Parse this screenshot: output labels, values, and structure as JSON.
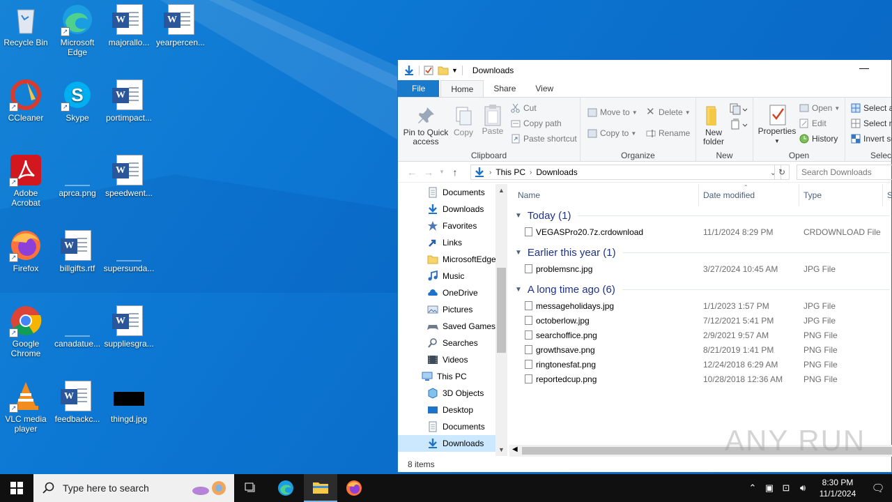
{
  "desktop": {
    "icons": [
      {
        "label": "Recycle Bin",
        "icon": "recycle-bin-icon"
      },
      {
        "label": "Microsoft Edge",
        "icon": "edge-icon"
      },
      {
        "label": "majorallo...",
        "icon": "word-doc-icon"
      },
      {
        "label": "yearpercen...",
        "icon": "word-doc-icon"
      },
      {
        "label": "CCleaner",
        "icon": "ccleaner-icon"
      },
      {
        "label": "Skype",
        "icon": "skype-icon"
      },
      {
        "label": "portimpact...",
        "icon": "word-doc-icon"
      },
      {
        "label": "Adobe Acrobat",
        "icon": "acrobat-icon"
      },
      {
        "label": "aprca.png",
        "icon": "image-file-icon"
      },
      {
        "label": "speedwent...",
        "icon": "word-doc-icon"
      },
      {
        "label": "Firefox",
        "icon": "firefox-icon"
      },
      {
        "label": "billgifts.rtf",
        "icon": "word-doc-icon"
      },
      {
        "label": "supersunda...",
        "icon": "image-file-icon"
      },
      {
        "label": "Google Chrome",
        "icon": "chrome-icon"
      },
      {
        "label": "canadatue...",
        "icon": "image-file-icon"
      },
      {
        "label": "suppliesgra...",
        "icon": "word-doc-icon"
      },
      {
        "label": "VLC media player",
        "icon": "vlc-icon"
      },
      {
        "label": "feedbackc...",
        "icon": "word-doc-icon"
      },
      {
        "label": "thingd.jpg",
        "icon": "image-thumbnail-icon"
      }
    ]
  },
  "explorer": {
    "title": "Downloads",
    "tabs": [
      "File",
      "Home",
      "Share",
      "View"
    ],
    "ribbon": {
      "clipboard": {
        "name": "Clipboard",
        "pin": "Pin to Quick access",
        "copy": "Copy",
        "paste": "Paste",
        "cut": "Cut",
        "copy_path": "Copy path",
        "paste_shortcut": "Paste shortcut"
      },
      "organize": {
        "name": "Organize",
        "move_to": "Move to",
        "copy_to": "Copy to",
        "delete": "Delete",
        "rename": "Rename"
      },
      "new": {
        "name": "New",
        "new_folder": "New folder"
      },
      "open": {
        "name": "Open",
        "properties": "Properties",
        "open": "Open",
        "edit": "Edit",
        "history": "History"
      },
      "select": {
        "name": "Selec",
        "select_all": "Select a",
        "select_none": "Select n",
        "invert": "Invert se"
      }
    },
    "address": {
      "pc": "This PC",
      "folder": "Downloads"
    },
    "search_placeholder": "Search Downloads",
    "nav_items": [
      {
        "label": "Documents",
        "icon": "documents-icon"
      },
      {
        "label": "Downloads",
        "icon": "downloads-icon"
      },
      {
        "label": "Favorites",
        "icon": "favorites-icon"
      },
      {
        "label": "Links",
        "icon": "links-icon"
      },
      {
        "label": "MicrosoftEdge",
        "icon": "folder-icon"
      },
      {
        "label": "Music",
        "icon": "music-icon"
      },
      {
        "label": "OneDrive",
        "icon": "onedrive-icon"
      },
      {
        "label": "Pictures",
        "icon": "pictures-icon"
      },
      {
        "label": "Saved Games",
        "icon": "saved-games-icon"
      },
      {
        "label": "Searches",
        "icon": "searches-icon"
      },
      {
        "label": "Videos",
        "icon": "videos-icon"
      },
      {
        "label": "This PC",
        "icon": "this-pc-icon"
      },
      {
        "label": "3D Objects",
        "icon": "3d-objects-icon"
      },
      {
        "label": "Desktop",
        "icon": "desktop-icon"
      },
      {
        "label": "Documents",
        "icon": "documents-icon"
      },
      {
        "label": "Downloads",
        "icon": "downloads-icon"
      }
    ],
    "columns": {
      "name": "Name",
      "date": "Date modified",
      "type": "Type",
      "size": "S"
    },
    "groups": [
      {
        "title": "Today (1)",
        "files": [
          {
            "name": "VEGASPro20.7z.crdownload",
            "date": "11/1/2024 8:29 PM",
            "type": "CRDOWNLOAD File"
          }
        ]
      },
      {
        "title": "Earlier this year (1)",
        "files": [
          {
            "name": "problemsnc.jpg",
            "date": "3/27/2024 10:45 AM",
            "type": "JPG File"
          }
        ]
      },
      {
        "title": "A long time ago (6)",
        "files": [
          {
            "name": "messageholidays.jpg",
            "date": "1/1/2023 1:57 PM",
            "type": "JPG File"
          },
          {
            "name": "octoberlow.jpg",
            "date": "7/12/2021 5:41 PM",
            "type": "JPG File"
          },
          {
            "name": "searchoffice.png",
            "date": "2/9/2021 9:57 AM",
            "type": "PNG File"
          },
          {
            "name": "growthsave.png",
            "date": "8/21/2019 1:41 PM",
            "type": "PNG File"
          },
          {
            "name": "ringtonesfat.png",
            "date": "12/24/2018 6:29 AM",
            "type": "PNG File"
          },
          {
            "name": "reportedcup.png",
            "date": "10/28/2018 12:36 AM",
            "type": "PNG File"
          }
        ]
      }
    ],
    "status": "8 items"
  },
  "watermark": "ANY RUN",
  "taskbar": {
    "search_placeholder": "Type here to search",
    "time": "8:30 PM",
    "date": "11/1/2024"
  },
  "colors": {
    "accent": "#1979ca",
    "desktop": "#0a6fcb",
    "taskbar": "#101010",
    "selection": "#cce8ff"
  }
}
